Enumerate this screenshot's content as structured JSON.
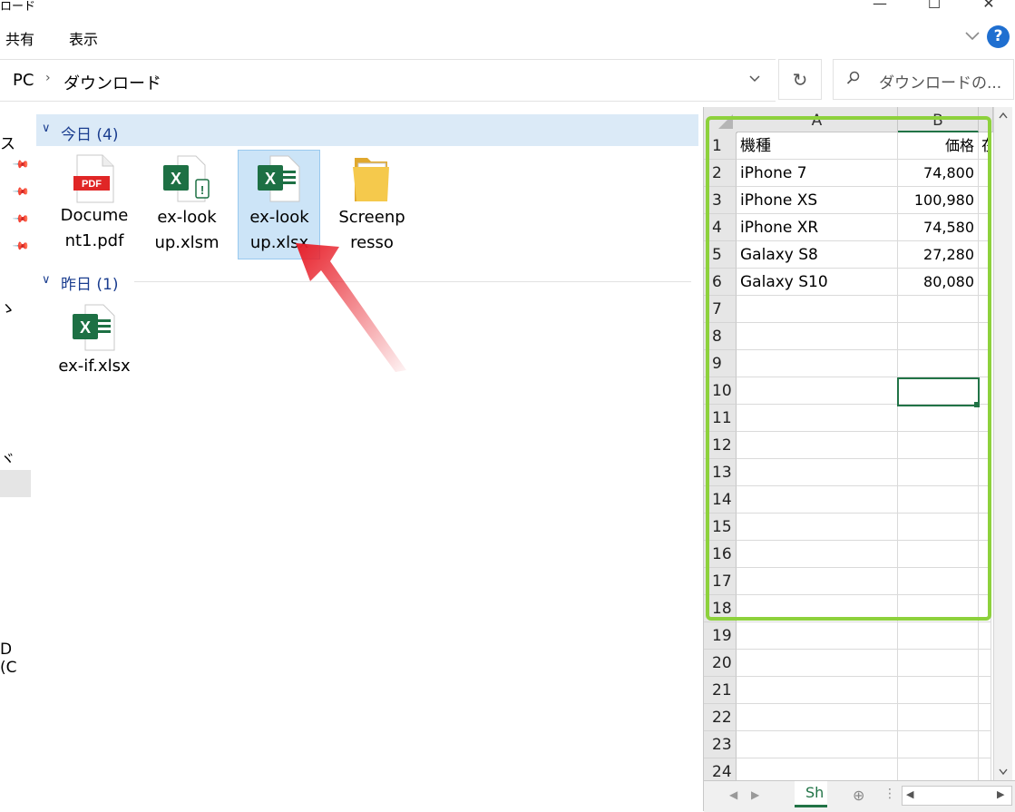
{
  "window": {
    "title": "ロード"
  },
  "ribbon": {
    "tabs": [
      "共有",
      "表示"
    ]
  },
  "address": {
    "segments": [
      "PC",
      "ダウンロード"
    ],
    "search_placeholder": "ダウンロードの..."
  },
  "nav": {
    "fragments": [
      "ス",
      "ゝ",
      "ヾ",
      "D (C"
    ]
  },
  "groups": [
    {
      "header": "今日 (4)",
      "files": [
        {
          "name": "Document1.pdf",
          "line1": "Docume",
          "line2": "nt1.pdf",
          "icon": "pdf-icon"
        },
        {
          "name": "ex-lookup.xlsm",
          "line1": "ex-look",
          "line2": "up.xlsm",
          "icon": "excel-macro-icon"
        },
        {
          "name": "ex-lookup.xlsx",
          "line1": "ex-look",
          "line2": "up.xlsx",
          "icon": "excel-icon",
          "selected": true
        },
        {
          "name": "Screenpresso",
          "line1": "Screenp",
          "line2": "resso",
          "icon": "folder-icon"
        }
      ]
    },
    {
      "header": "昨日 (1)",
      "files": [
        {
          "name": "ex-if.xlsx",
          "line1": "ex-if.xlsx",
          "line2": "",
          "icon": "excel-icon"
        }
      ]
    }
  ],
  "excel": {
    "columns": [
      "A",
      "B"
    ],
    "rows": [
      "1",
      "2",
      "3",
      "4",
      "5",
      "6",
      "7",
      "8",
      "9",
      "10",
      "11",
      "12",
      "13",
      "14",
      "15",
      "16",
      "17",
      "18",
      "19",
      "20",
      "21",
      "22",
      "23",
      "24"
    ],
    "cells": [
      {
        "a": "機種",
        "b": "価格",
        "c": "在"
      },
      {
        "a": "iPhone 7",
        "b": "74,800"
      },
      {
        "a": "iPhone XS",
        "b": "100,980"
      },
      {
        "a": "iPhone XR",
        "b": "74,580"
      },
      {
        "a": "Galaxy S8",
        "b": "27,280"
      },
      {
        "a": "Galaxy S10",
        "b": "80,080"
      }
    ],
    "active_cell": "B10",
    "sheet_tab": "Sh"
  },
  "colors": {
    "highlight": "#8dd13c",
    "arrow": "#e8202a",
    "excel_green": "#217346",
    "selection": "#cce4f7"
  }
}
